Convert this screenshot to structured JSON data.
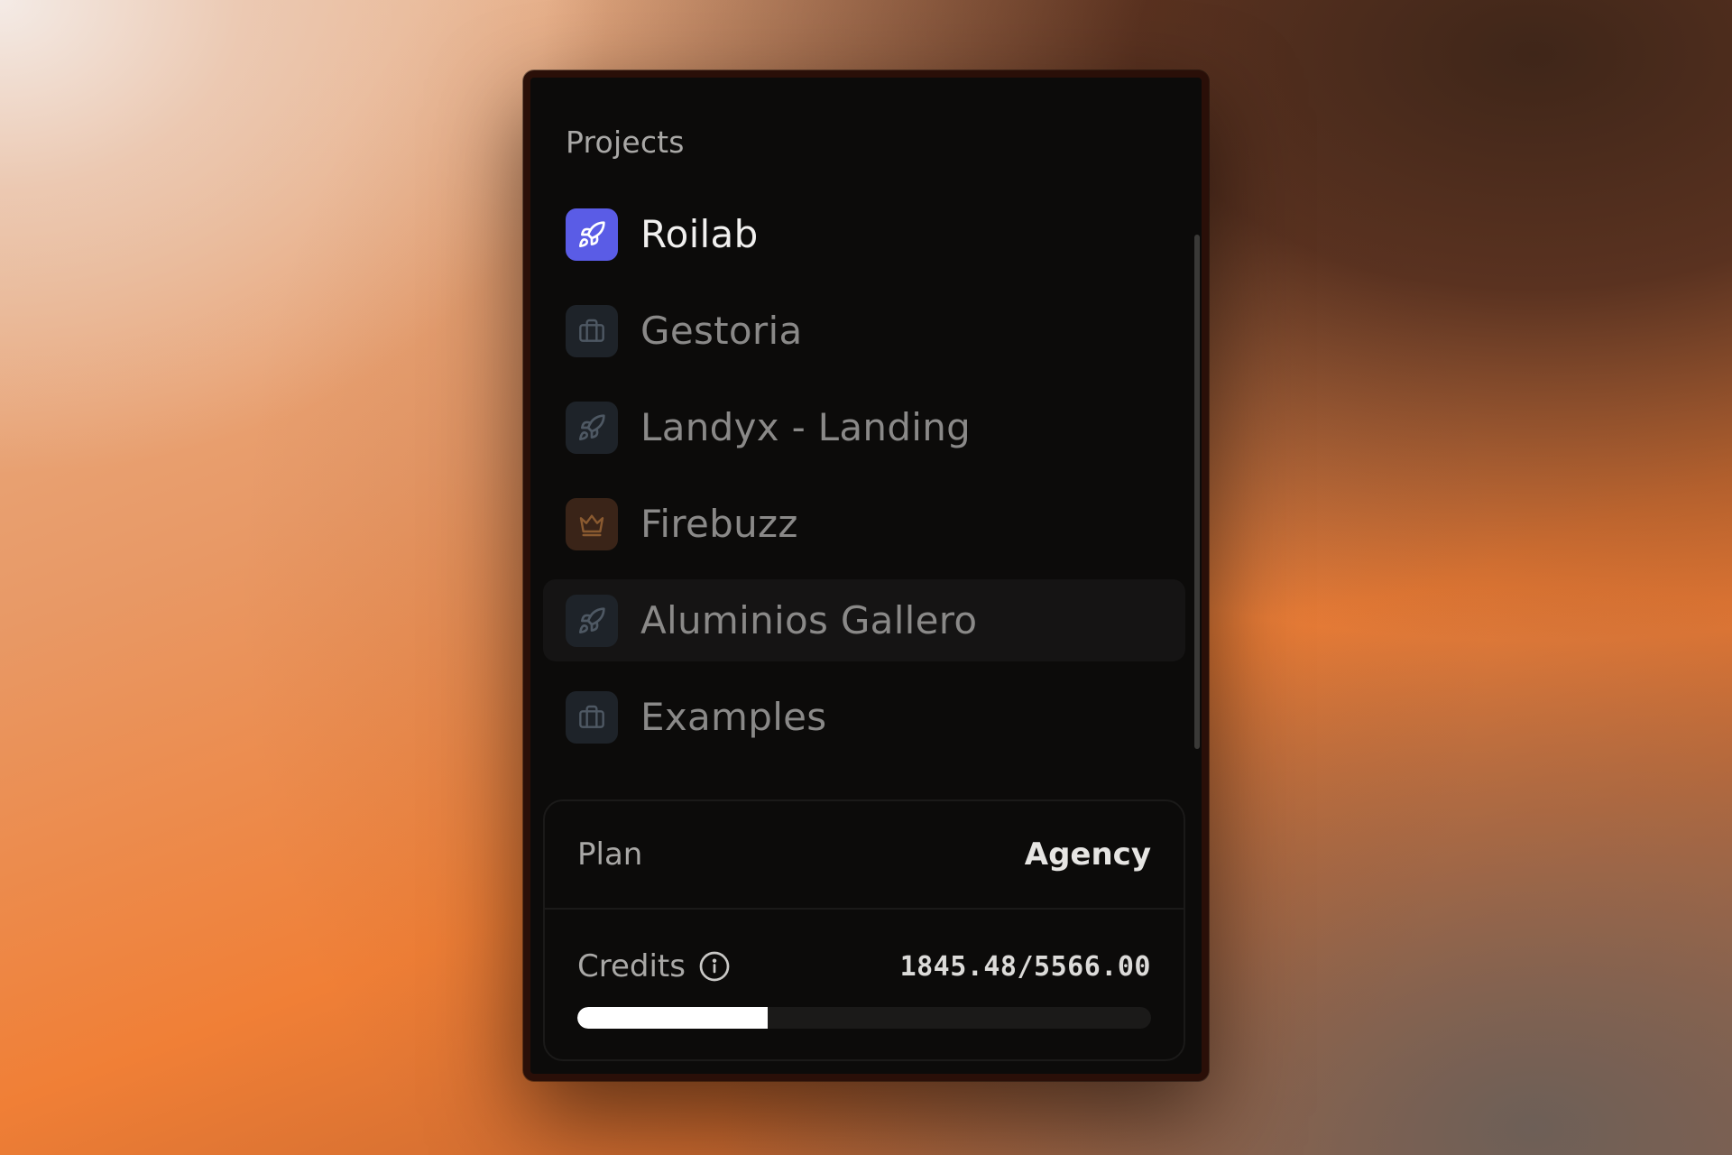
{
  "projects": {
    "title": "Projects",
    "items": [
      {
        "label": "Roilab",
        "icon": "rocket-icon",
        "state": "active"
      },
      {
        "label": "Gestoria",
        "icon": "briefcase-icon",
        "state": "normal"
      },
      {
        "label": "Landyx - Landing",
        "icon": "rocket-icon",
        "state": "normal"
      },
      {
        "label": "Firebuzz",
        "icon": "crown-icon",
        "state": "normal"
      },
      {
        "label": "Aluminios Gallero",
        "icon": "rocket-icon",
        "state": "hover"
      },
      {
        "label": "Examples",
        "icon": "briefcase-icon",
        "state": "normal"
      }
    ]
  },
  "plan": {
    "label": "Plan",
    "value": "Agency"
  },
  "credits": {
    "label": "Credits",
    "value": "1845.48/5566.00",
    "used": 1845.48,
    "total": 5566.0
  },
  "colors": {
    "accent": "#5a5ce6",
    "panel_bg": "#0c0b0a",
    "progress_fill": "#ffffff"
  }
}
